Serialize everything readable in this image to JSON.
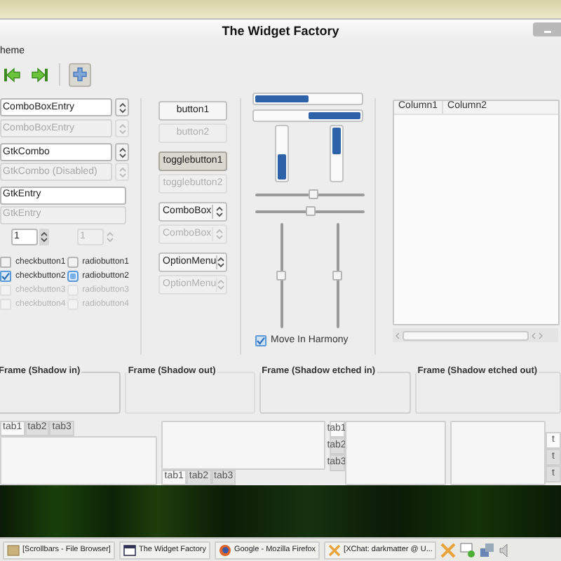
{
  "window": {
    "title": "The Widget Factory"
  },
  "menu": [
    "heme"
  ],
  "toolbar": [
    {
      "kind": "back",
      "pressed": false
    },
    {
      "kind": "forward",
      "pressed": false
    },
    {
      "kind": "separator"
    },
    {
      "kind": "add",
      "pressed": true
    }
  ],
  "combo_entries": [
    {
      "value": "ComboBoxEntry",
      "disabled": false
    },
    {
      "value": "ComboBoxEntry",
      "disabled": true
    },
    {
      "value": "GtkCombo",
      "disabled": false
    },
    {
      "value": "GtkCombo (Disabled)",
      "disabled": true
    }
  ],
  "entries": [
    {
      "value": "GtkEntry",
      "disabled": false
    },
    {
      "value": "GtkEntry",
      "disabled": true
    }
  ],
  "spin_buttons": [
    {
      "value": "1",
      "disabled": false
    },
    {
      "value": "1",
      "disabled": true
    }
  ],
  "check_buttons": [
    {
      "label": "checkbutton1",
      "checked": false,
      "disabled": false
    },
    {
      "label": "checkbutton2",
      "checked": true,
      "disabled": false
    },
    {
      "label": "checkbutton3",
      "checked": false,
      "disabled": true
    },
    {
      "label": "checkbutton4",
      "checked": false,
      "disabled": true
    }
  ],
  "radio_buttons": [
    {
      "label": "radiobutton1",
      "selected": false,
      "disabled": false
    },
    {
      "label": "radiobutton2",
      "selected": true,
      "disabled": false
    },
    {
      "label": "radiobutton3",
      "selected": false,
      "disabled": true
    },
    {
      "label": "radiobutton4",
      "selected": false,
      "disabled": true
    }
  ],
  "buttons": [
    {
      "kind": "button",
      "label": "button1",
      "disabled": false
    },
    {
      "kind": "button",
      "label": "button2",
      "disabled": true
    },
    {
      "kind": "toggle",
      "label": "togglebutton1",
      "disabled": false,
      "pressed": true
    },
    {
      "kind": "toggle",
      "label": "togglebutton2",
      "disabled": true,
      "pressed": false
    },
    {
      "kind": "combo",
      "label": "ComboBox",
      "disabled": false
    },
    {
      "kind": "combo",
      "label": "ComboBox",
      "disabled": true
    },
    {
      "kind": "combo",
      "label": "OptionMenu",
      "disabled": false
    },
    {
      "kind": "combo",
      "label": "OptionMenu",
      "disabled": true
    }
  ],
  "progress_bars": [
    {
      "kind": "horizontal",
      "level": 0.5
    },
    {
      "kind": "horizontal_inverted",
      "level": 0.5
    }
  ],
  "vertical_progress_bars": [
    {
      "kind": "vertical",
      "level": 0.5
    },
    {
      "kind": "vertical_inverted",
      "level": 0.5
    }
  ],
  "horizontal_scales": [
    {
      "level": 0.53
    },
    {
      "level": 0.5
    }
  ],
  "vertical_scales": [
    {
      "level": 0.5
    },
    {
      "level": 0.5
    }
  ],
  "harmony": {
    "label": "Move In Harmony",
    "checked": true
  },
  "tree": {
    "columns": [
      "Column1",
      "Column2"
    ]
  },
  "frames": [
    {
      "kind": "in",
      "label": "Frame (Shadow in)"
    },
    {
      "kind": "out",
      "label": "Frame (Shadow out)"
    },
    {
      "kind": "etched_in",
      "label": "Frame (Shadow etched in)"
    },
    {
      "kind": "etched_out",
      "label": "Frame (Shadow etched out)"
    }
  ],
  "notebooks": [
    {
      "kind": "top",
      "tabs": [
        {
          "label": "tab1",
          "selected": true
        },
        {
          "label": "tab2",
          "selected": false
        },
        {
          "label": "tab3",
          "selected": false
        }
      ]
    },
    {
      "kind": "bottom",
      "tabs": [
        {
          "label": "tab1",
          "selected": true
        },
        {
          "label": "tab2",
          "selected": false
        },
        {
          "label": "tab3",
          "selected": false
        }
      ]
    },
    {
      "kind": "left",
      "tabs": [
        {
          "label": "tab1",
          "selected": true
        },
        {
          "label": "tab2",
          "selected": false
        },
        {
          "label": "tab3",
          "selected": false
        }
      ]
    },
    {
      "kind": "right",
      "tabs": [
        {
          "label": "t",
          "selected": true
        },
        {
          "label": "t",
          "selected": false
        },
        {
          "label": "t",
          "selected": false
        }
      ]
    }
  ],
  "taskbar": [
    {
      "kind": "folder",
      "label": "[Scrollbars - File Browser]"
    },
    {
      "kind": "window",
      "label": "The Widget Factory"
    },
    {
      "kind": "browser",
      "label": "Google - Mozilla Firefox"
    },
    {
      "kind": "chat",
      "label": "[XChat: darkmatter @ U..."
    }
  ]
}
